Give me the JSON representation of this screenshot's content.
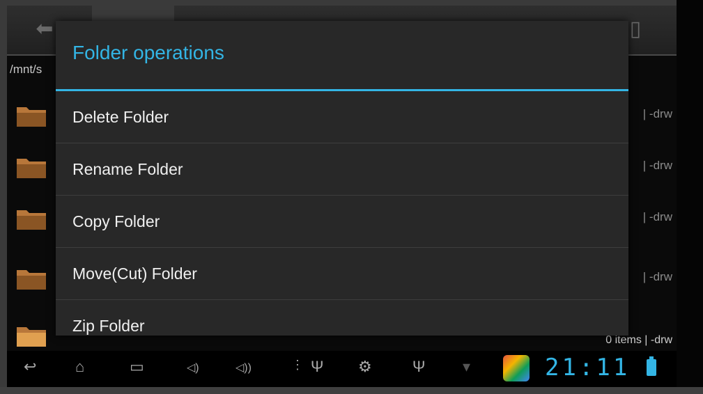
{
  "dialog": {
    "title": "Folder operations",
    "items": [
      {
        "label": "Delete Folder"
      },
      {
        "label": "Rename Folder"
      },
      {
        "label": "Copy Folder"
      },
      {
        "label": "Move(Cut) Folder"
      },
      {
        "label": "Zip Folder"
      }
    ]
  },
  "file_list": {
    "path": "/mnt/s",
    "rows": [
      {
        "permissions": "| -drw"
      },
      {
        "permissions": "| -drw"
      },
      {
        "permissions": "| -drw"
      },
      {
        "permissions": "| -drw"
      }
    ],
    "summary": "0 items | -drw"
  },
  "status_bar": {
    "time": "21:11"
  },
  "colors": {
    "accent": "#33b5e5",
    "dialog_bg": "#282828",
    "folder": "#b8773a"
  }
}
